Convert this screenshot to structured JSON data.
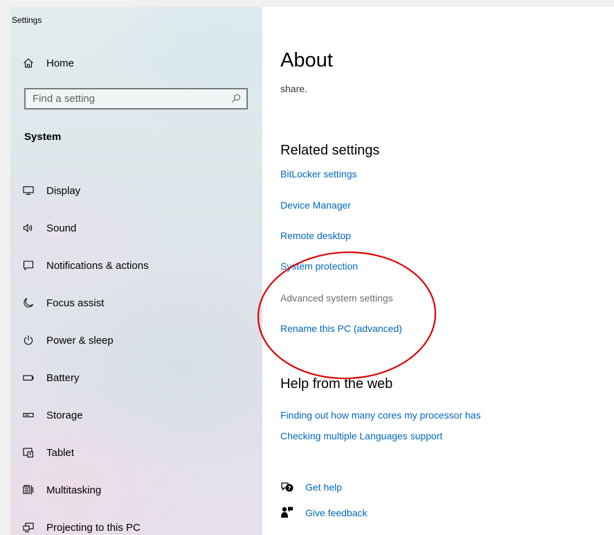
{
  "window": {
    "title": "Settings"
  },
  "sidebar": {
    "home": {
      "label": "Home",
      "icon": "home-icon"
    },
    "search": {
      "placeholder": "Find a setting",
      "value": ""
    },
    "section": "System",
    "items": [
      {
        "label": "Display",
        "icon": "display-icon"
      },
      {
        "label": "Sound",
        "icon": "sound-icon"
      },
      {
        "label": "Notifications & actions",
        "icon": "notifications-icon"
      },
      {
        "label": "Focus assist",
        "icon": "moon-icon"
      },
      {
        "label": "Power & sleep",
        "icon": "power-icon"
      },
      {
        "label": "Battery",
        "icon": "battery-icon"
      },
      {
        "label": "Storage",
        "icon": "storage-icon"
      },
      {
        "label": "Tablet",
        "icon": "tablet-icon"
      },
      {
        "label": "Multitasking",
        "icon": "multitasking-icon"
      },
      {
        "label": "Projecting to this PC",
        "icon": "projecting-icon"
      }
    ]
  },
  "main": {
    "title": "About",
    "share_text": "share.",
    "related": {
      "heading": "Related settings",
      "links": [
        {
          "label": "BitLocker settings",
          "enabled": true
        },
        {
          "label": "Device Manager",
          "enabled": true
        },
        {
          "label": "Remote desktop",
          "enabled": true
        },
        {
          "label": "System protection",
          "enabled": true
        },
        {
          "label": "Advanced system settings",
          "enabled": false
        },
        {
          "label": "Rename this PC (advanced)",
          "enabled": true
        }
      ]
    },
    "help": {
      "heading": "Help from the web",
      "links": [
        {
          "label": "Finding out how many cores my processor has"
        },
        {
          "label": "Checking multiple Languages support"
        }
      ]
    },
    "footer": {
      "get_help": {
        "label": "Get help",
        "icon": "get-help-icon"
      },
      "give_feedback": {
        "label": "Give feedback",
        "icon": "feedback-icon"
      }
    }
  },
  "colors": {
    "link": "#0067c0",
    "disabled_link": "#6d6d6d",
    "annotation": "#e00000"
  }
}
